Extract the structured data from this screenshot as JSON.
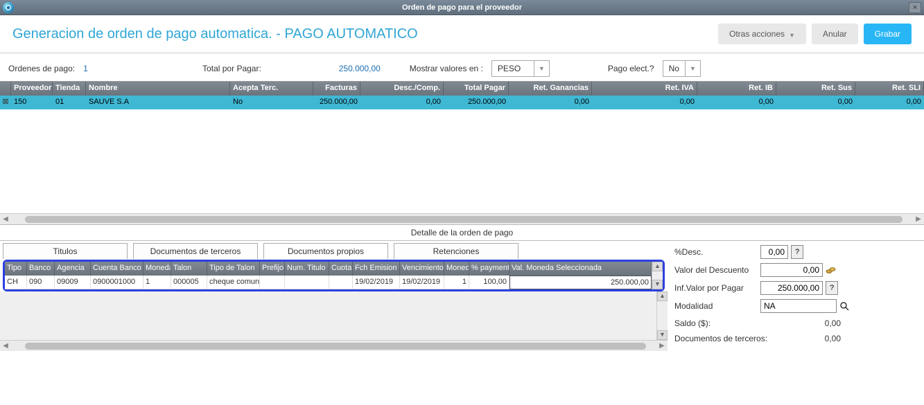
{
  "window": {
    "title": "Orden de pago para el proveedor",
    "close": "×"
  },
  "header": {
    "title": "Generacion de orden de pago automatica. - PAGO AUTOMATICO",
    "other_actions": "Otras acciones",
    "cancel": "Anular",
    "save": "Grabar"
  },
  "summary": {
    "orders_label": "Ordenes de pago:",
    "orders_value": "1",
    "total_label": "Total por Pagar:",
    "total_value": "250.000,00",
    "show_label": "Mostrar valores en :",
    "currency_value": "PESO",
    "elect_label": "Pago elect.?",
    "elect_value": "No"
  },
  "main_grid": {
    "columns": [
      "Proveedor",
      "Tienda",
      "Nombre",
      "Acepta Terc.",
      "Facturas",
      "Desc./Comp.",
      "Total Pagar",
      "Ret. Ganancias",
      "Ret. IVA",
      "Ret. IB",
      "Ret. Sus",
      "Ret. SLI"
    ],
    "row_x": "⊠",
    "row": [
      "150",
      "01",
      "SAUVE S.A",
      "No",
      "250.000,00",
      "0,00",
      "250.000,00",
      "0,00",
      "0,00",
      "0,00",
      "0,00",
      "0,00"
    ]
  },
  "detail_title": "Detalle de la orden de pago",
  "tabs": {
    "titulos": "Titulos",
    "terceros": "Documentos de terceros",
    "propios": "Documentos propios",
    "retenciones": "Retenciones"
  },
  "detail_grid": {
    "columns": [
      "Tipo",
      "Banco",
      "Agencia",
      "Cuenta Banco",
      "Moneda",
      "Talon",
      "Tipo de Talon",
      "Prefijo",
      "Num. Titulo",
      "Cuota",
      "Fch Emision",
      "Vencimiento",
      "Moneda",
      "% payment",
      "Val. Moneda Seleccionada"
    ],
    "row": [
      "CH",
      "090",
      "09009",
      "0900001000",
      "1",
      "000005",
      "cheque comun",
      "",
      "",
      "",
      "19/02/2019",
      "19/02/2019",
      "1",
      "100,00",
      "250.000,00"
    ]
  },
  "side": {
    "desc_label": "%Desc.",
    "desc_value": "0,00",
    "q": "?",
    "discount_label": "Valor del Descuento",
    "discount_value": "0,00",
    "inf_label": "Inf.Valor por Pagar",
    "inf_value": "250.000,00",
    "modalidad_label": "Modalidad",
    "modalidad_value": "NA",
    "saldo_label": "Saldo ($):",
    "saldo_value": "0,00",
    "terceros_label": "Documentos de terceros:",
    "terceros_value": "0,00"
  }
}
